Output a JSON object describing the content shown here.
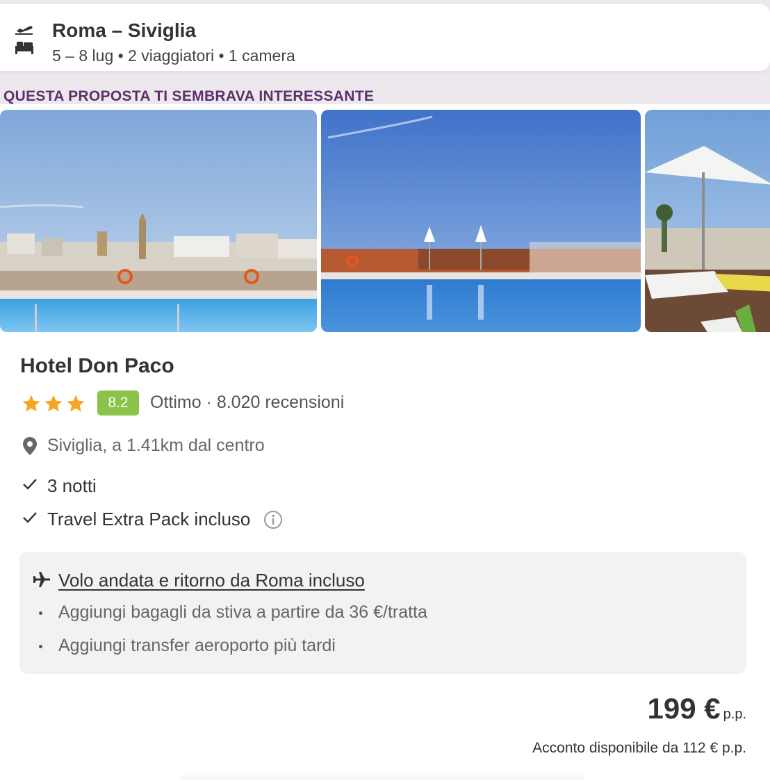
{
  "search": {
    "title": "Roma – Siviglia",
    "subtitle": "5 – 8 lug • 2 viaggiatori • 1 camera",
    "icons": [
      "plane-departure-icon",
      "bed-icon"
    ]
  },
  "suggestion": {
    "label": "QUESTA PROPOSTA TI SEMBRAVA INTERESSANTE"
  },
  "hotel": {
    "name": "Hotel Don Paco",
    "stars": 3,
    "score": "8.2",
    "score_text": "Ottimo · 8.020 recensioni",
    "location": "Siviglia, a 1.41km dal centro",
    "features": [
      "3 notti",
      "Travel Extra Pack incluso"
    ],
    "photos": [
      {
        "name": "rooftop-pool-city-view"
      },
      {
        "name": "rooftop-pool-reflection"
      },
      {
        "name": "terrace-umbrella-loungers"
      }
    ]
  },
  "flight": {
    "headline": "Volo andata e ritorno da Roma incluso",
    "notes": [
      "Aggiungi bagagli da stiva a partire da 36 €/tratta",
      "Aggiungi transfer aeroporto più tardi"
    ]
  },
  "price": {
    "value": "199 €",
    "unit": "p.p.",
    "deposit": "Acconto disponibile da 112 € p.p."
  },
  "colors": {
    "accent_purple": "#5e2f6c",
    "score_green": "#8bc34a",
    "star_orange": "#f5a623",
    "background": "#ede8ee"
  }
}
